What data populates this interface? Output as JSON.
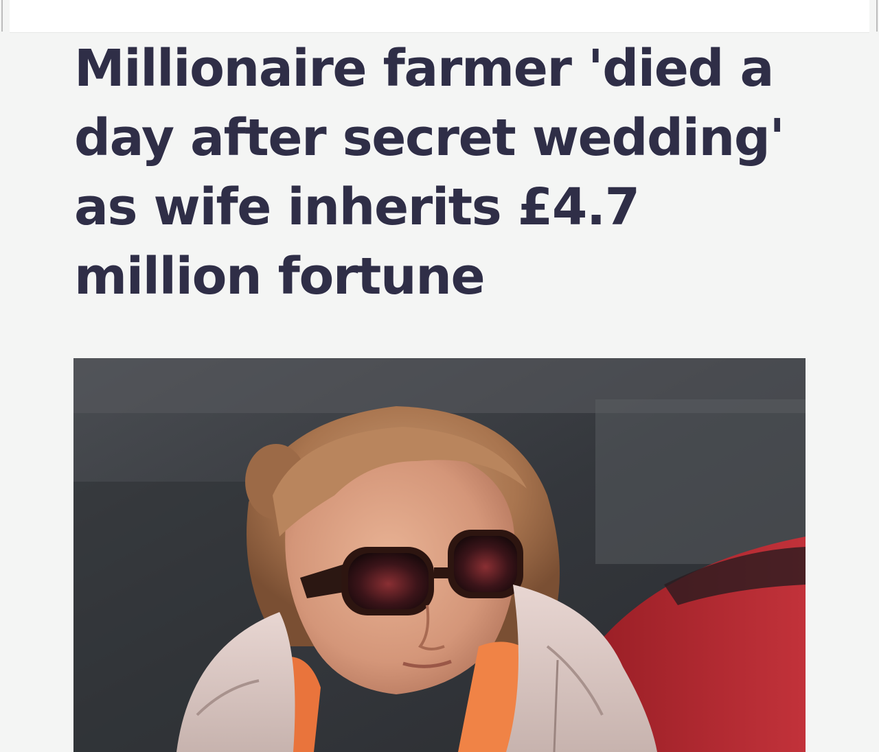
{
  "article": {
    "headline": "Millionaire farmer 'died a day after secret wedding' as wife inherits £4.7 million fortune"
  },
  "colors": {
    "page_background": "#f4f5f4",
    "headline_text": "#2f2e47",
    "top_bar": "#ffffff"
  }
}
